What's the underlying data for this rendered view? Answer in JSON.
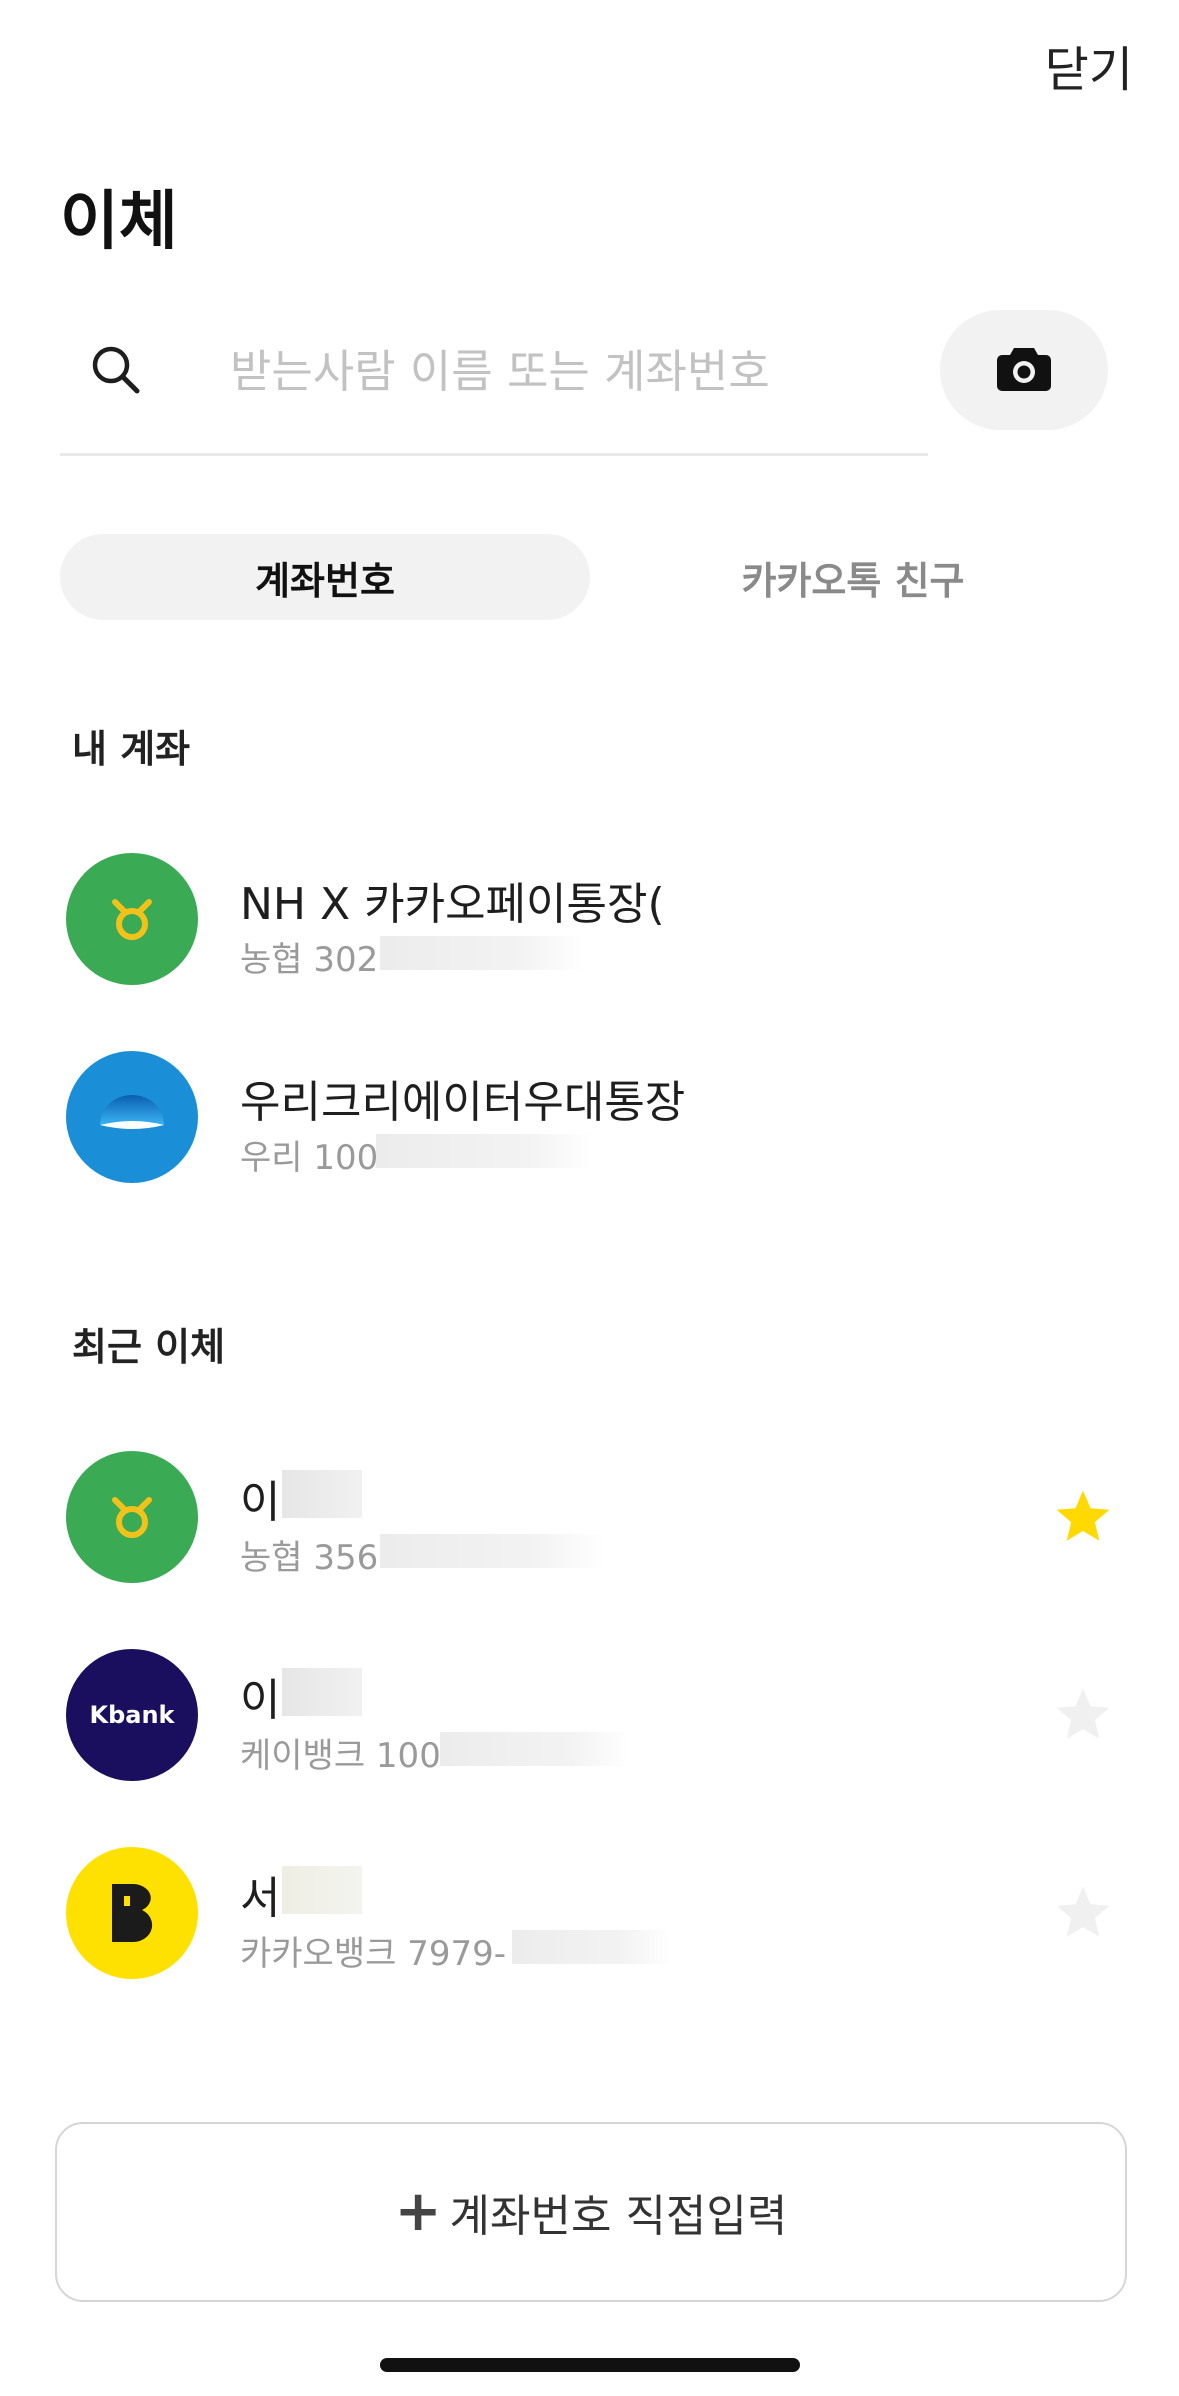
{
  "header": {
    "close_label": "닫기",
    "title": "이체"
  },
  "search": {
    "placeholder": "받는사람 이름 또는 계좌번호",
    "value": ""
  },
  "tabs": [
    {
      "label": "계좌번호",
      "active": true
    },
    {
      "label": "카카오톡 친구",
      "active": false
    }
  ],
  "my_accounts": {
    "title": "내 계좌",
    "items": [
      {
        "name": "NH X 카카오페이통장(",
        "sub": "농협 302",
        "bank_icon": "nh-bank-logo-icon"
      },
      {
        "name": "우리크리에이터우대통장",
        "sub": "우리 100",
        "bank_icon": "woori-bank-logo-icon"
      }
    ]
  },
  "recent": {
    "title": "최근 이체",
    "items": [
      {
        "name": "이",
        "sub": "농협 356",
        "bank_icon": "nh-bank-logo-icon",
        "favorite": true
      },
      {
        "name": "이",
        "sub": "케이뱅크 100",
        "bank_icon": "kbank-logo-icon",
        "logo_text": "Kbank",
        "favorite": false
      },
      {
        "name": "서",
        "sub": "카카오뱅크 7979-",
        "bank_icon": "kakaobank-logo-icon",
        "favorite": false
      }
    ]
  },
  "add_button": {
    "plus": "+",
    "label": "계좌번호 직접입력"
  },
  "colors": {
    "nh_green": "#3aaa54",
    "woori_blue": "#1a8fd8",
    "kbank_navy": "#1a0f5e",
    "kakao_yellow": "#ffe100",
    "star_active": "#ffd900",
    "star_inactive": "#f0f0f0"
  }
}
